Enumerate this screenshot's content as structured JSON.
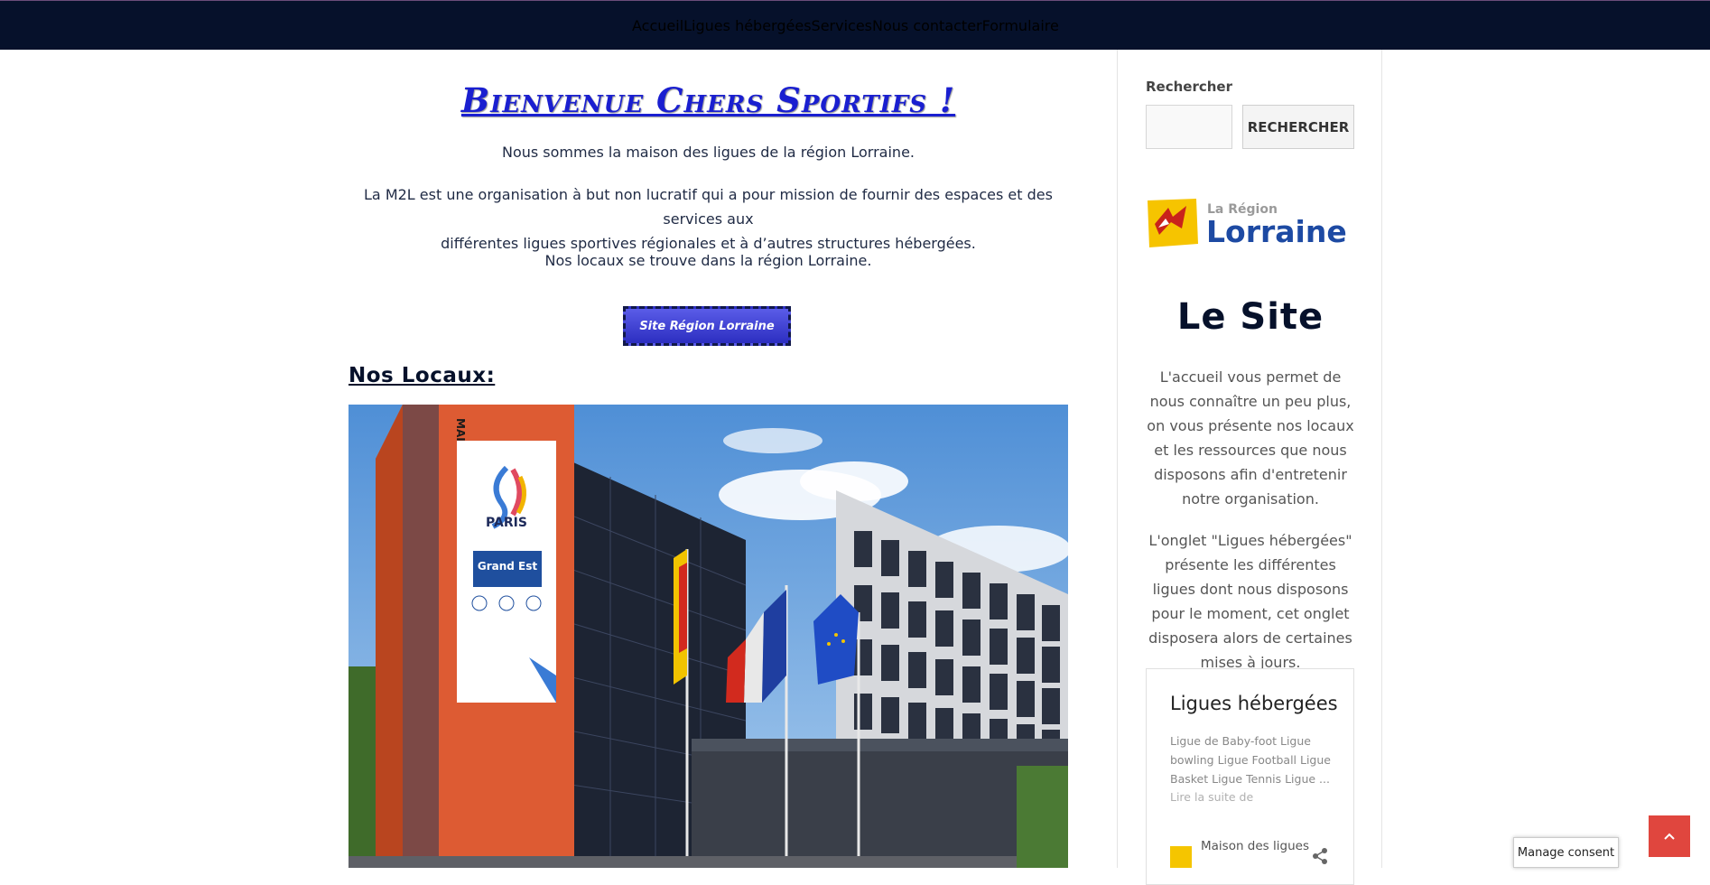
{
  "nav": {
    "items": [
      "Accueil",
      "Ligues hébergées",
      "Services",
      "Nous contacter",
      "Formulaire"
    ]
  },
  "main": {
    "welcome_title": "Bienvenue Chers Sportifs !",
    "para1": "Nous sommes la maison des ligues de la région Lorraine.",
    "para2_line1": "La M2L est une organisation à but non lucratif qui a pour mission de fournir des espaces et des services aux",
    "para2_line2": "différentes ligues sportives régionales et à d’autres structures hébergées.",
    "para3": "Nos locaux se trouve dans la région Lorraine.",
    "region_button": "Site Région Lorraine",
    "locaux_heading": "Nos Locaux:",
    "building_sign": "MAISON REGIONALE DES SPORTS",
    "banner_paris": "PARIS",
    "banner_grandest": "Grand Est"
  },
  "sidebar": {
    "search_label": "Rechercher",
    "search_button": "RECHERCHER",
    "logo_small": "La Région",
    "logo_big": "Lorraine",
    "site_title": "Le Site",
    "text1": "L'accueil vous permet de nous connaître un peu plus, on vous présente nos locaux et les ressources que nous disposons afin d'entretenir notre organisation.",
    "text2": "L'onglet \"Ligues hébergées\" présente les différentes ligues dont nous disposons pour le moment, cet onglet disposera alors de certaines mises à jours.",
    "card": {
      "title": "Ligues hébergées",
      "excerpt": "Ligue de Baby-foot Ligue bowling Ligue Football Ligue Basket Ligue Tennis Ligue ...",
      "read_more": "Lire la suite de",
      "author": "Maison des ligues"
    }
  },
  "consent": "Manage consent",
  "colors": {
    "navbar": "#06112b",
    "title_blue": "#1a1fd0",
    "back_to_top": "#e0463e"
  }
}
